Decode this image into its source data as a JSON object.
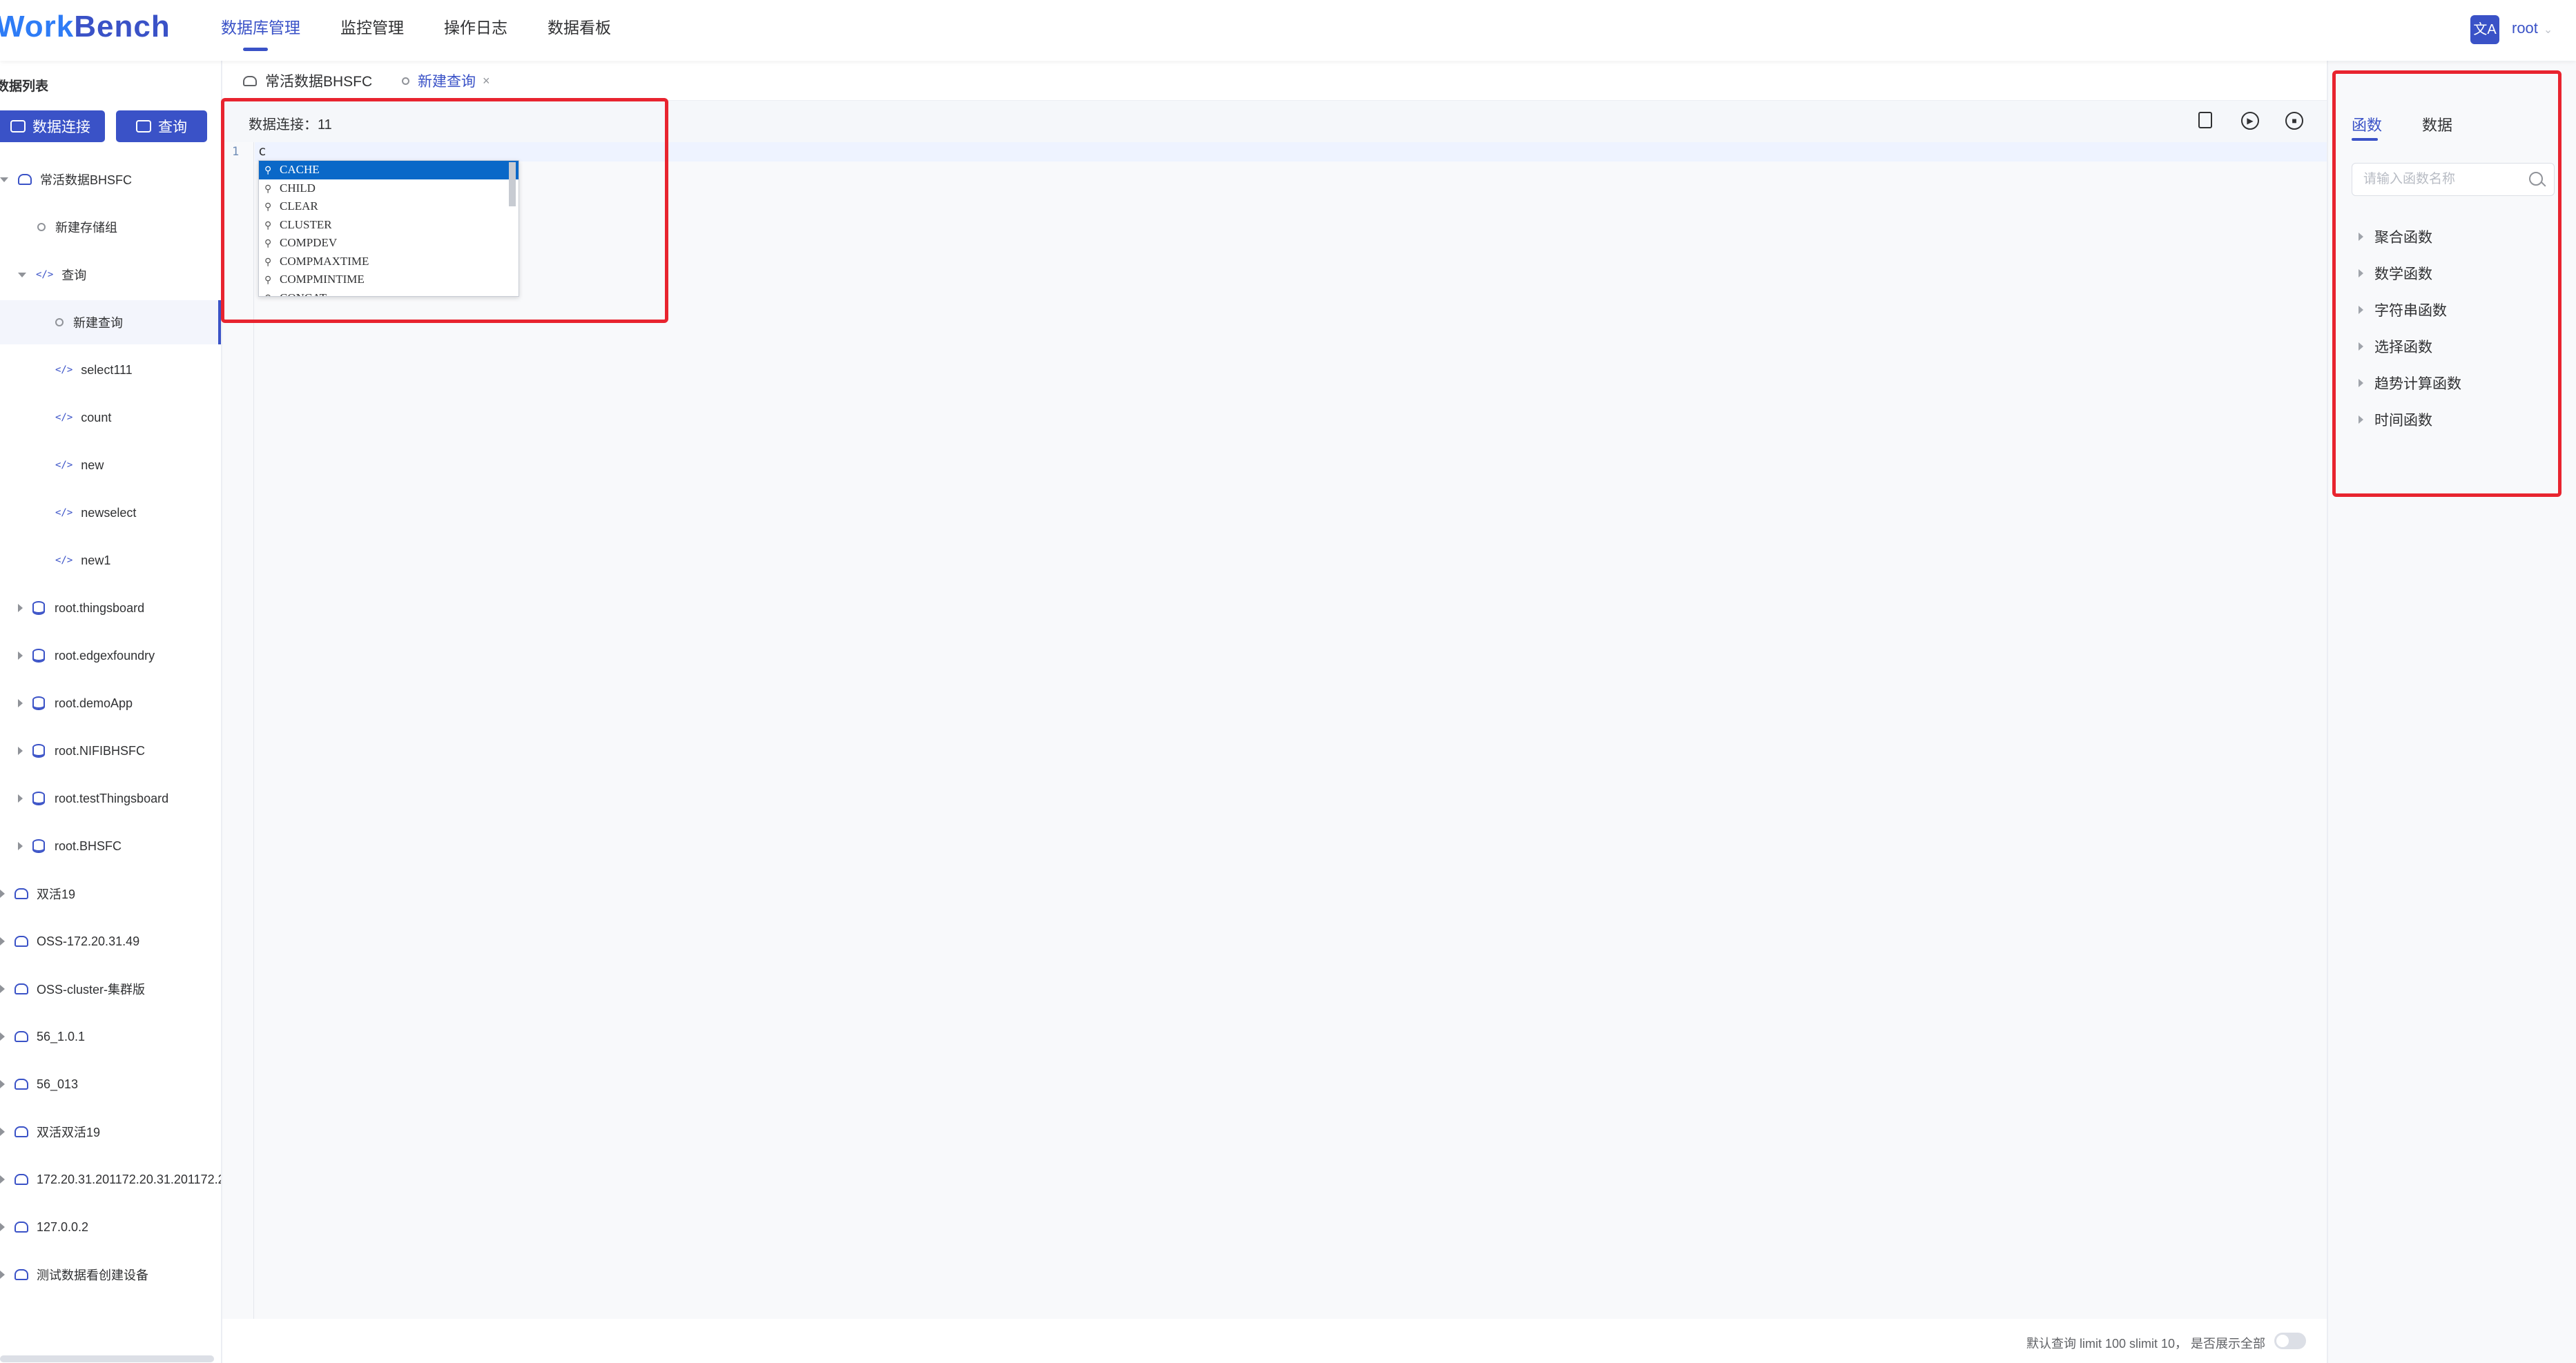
{
  "app": {
    "logo_prefix": "Work",
    "logo_suffix": "Bench"
  },
  "nav": [
    {
      "label": "数据库管理",
      "active": true
    },
    {
      "label": "监控管理"
    },
    {
      "label": "操作日志"
    },
    {
      "label": "数据看板"
    }
  ],
  "user": {
    "lang_icon": "文A",
    "name": "root",
    "caret": "⌄"
  },
  "sidebar": {
    "title": "数据列表",
    "btn_connection": "数据连接",
    "btn_query": "查询",
    "tree": [
      {
        "label": "常活数据BHSFC",
        "indent": 0,
        "arrow": "down",
        "icon": "db"
      },
      {
        "label": "新建存储组",
        "indent": 1,
        "arrow": "none",
        "icon": "dot"
      },
      {
        "label": "查询",
        "indent": 1,
        "arrow": "down",
        "icon": "code"
      },
      {
        "label": "新建查询",
        "indent": 2,
        "arrow": "none",
        "icon": "dot",
        "selected": true
      },
      {
        "label": "select111",
        "indent": 2,
        "arrow": "none",
        "icon": "code"
      },
      {
        "label": "count",
        "indent": 2,
        "arrow": "none",
        "icon": "code"
      },
      {
        "label": "new",
        "indent": 2,
        "arrow": "none",
        "icon": "code"
      },
      {
        "label": "newselect",
        "indent": 2,
        "arrow": "none",
        "icon": "code"
      },
      {
        "label": "new1",
        "indent": 2,
        "arrow": "none",
        "icon": "code"
      },
      {
        "label": "root.thingsboard",
        "indent": 1,
        "arrow": "right",
        "icon": "cyl"
      },
      {
        "label": "root.edgexfoundry",
        "indent": 1,
        "arrow": "right",
        "icon": "cyl"
      },
      {
        "label": "root.demoApp",
        "indent": 1,
        "arrow": "right",
        "icon": "cyl"
      },
      {
        "label": "root.NIFIBHSFC",
        "indent": 1,
        "arrow": "right",
        "icon": "cyl"
      },
      {
        "label": "root.testThingsboard",
        "indent": 1,
        "arrow": "right",
        "icon": "cyl"
      },
      {
        "label": "root.BHSFC",
        "indent": 1,
        "arrow": "right",
        "icon": "cyl"
      },
      {
        "label": "双活19",
        "indent": 0,
        "arrow": "right",
        "icon": "db"
      },
      {
        "label": "OSS-172.20.31.49",
        "indent": 0,
        "arrow": "right",
        "icon": "db"
      },
      {
        "label": "OSS-cluster-集群版",
        "indent": 0,
        "arrow": "right",
        "icon": "db"
      },
      {
        "label": "56_1.0.1",
        "indent": 0,
        "arrow": "right",
        "icon": "db"
      },
      {
        "label": "56_013",
        "indent": 0,
        "arrow": "right",
        "icon": "db"
      },
      {
        "label": "双活双活19",
        "indent": 0,
        "arrow": "right",
        "icon": "db"
      },
      {
        "label": "172.20.31.201172.20.31.201172.2",
        "indent": 0,
        "arrow": "right",
        "icon": "db"
      },
      {
        "label": "127.0.0.2",
        "indent": 0,
        "arrow": "right",
        "icon": "db"
      },
      {
        "label": "测试数据看创建设备",
        "indent": 0,
        "arrow": "right",
        "icon": "db"
      }
    ]
  },
  "tabs": [
    {
      "label": "常活数据BHSFC"
    },
    {
      "label": "新建查询",
      "active": true,
      "close": "×"
    }
  ],
  "editor": {
    "connection_label": "数据连接：11",
    "line_number": "1",
    "code": "c",
    "suggestions": [
      "CACHE",
      "CHILD",
      "CLEAR",
      "CLUSTER",
      "COMPDEV",
      "COMPMAXTIME",
      "COMPMINTIME",
      "CONCAT"
    ]
  },
  "footer": {
    "limit_text": "默认查询 limit 100 slimit 10，  是否展示全部"
  },
  "right_panel": {
    "tab_functions": "函数",
    "tab_data": "数据",
    "search_placeholder": "请输入函数名称",
    "categories": [
      "聚合函数",
      "数学函数",
      "字符串函数",
      "选择函数",
      "趋势计算函数",
      "时间函数"
    ]
  },
  "colors": {
    "accent": "#3a52c7",
    "highlight": "#e8242f",
    "suggest_active": "#0a68c8"
  }
}
